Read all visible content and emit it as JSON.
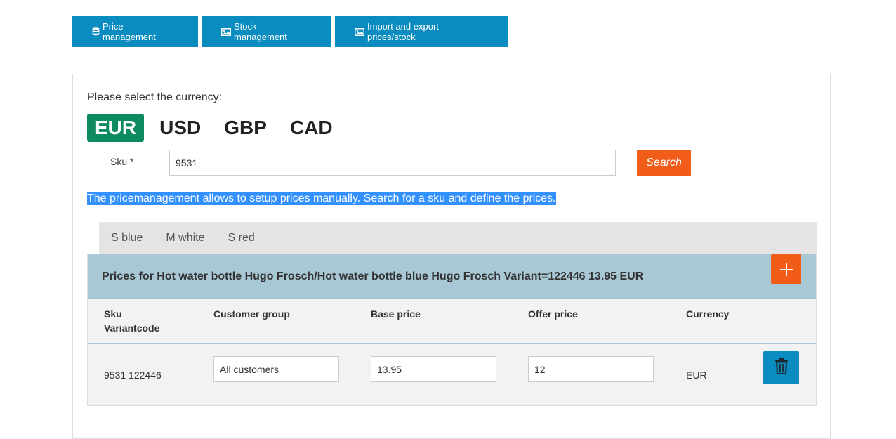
{
  "nav": {
    "price_management": "Price management",
    "stock_management": "Stock management",
    "import_export": "Import and export prices/stock"
  },
  "currency": {
    "label": "Please select the currency:",
    "options": [
      "EUR",
      "USD",
      "GBP",
      "CAD"
    ],
    "selected": "EUR"
  },
  "search": {
    "sku_label": "Sku *",
    "sku_value": "9531",
    "button": "Search"
  },
  "info_text": "The pricemanagement allows to setup prices manually. Search for a sku and define the prices.",
  "variant_tabs": [
    "S blue",
    "M white",
    "S red"
  ],
  "prices": {
    "title": "Prices for Hot water bottle Hugo Frosch/Hot water bottle blue Hugo Frosch Variant=122446 13.95 EUR",
    "add_icon": "plus-icon",
    "columns": {
      "sku_line1": "Sku",
      "sku_line2": "Variantcode",
      "customer_group": "Customer group",
      "base_price": "Base price",
      "offer_price": "Offer price",
      "currency": "Currency"
    },
    "rows": [
      {
        "sku_variant": "9531 122446",
        "customer_group": "All customers",
        "base_price": "13.95",
        "offer_price": "12",
        "currency": "EUR",
        "delete_icon": "trash-icon"
      }
    ]
  },
  "colors": {
    "nav_blue": "#0a8cc0",
    "orange": "#f25c19",
    "active_green": "#0e8a5f",
    "card_head": "#a8c8d6"
  }
}
